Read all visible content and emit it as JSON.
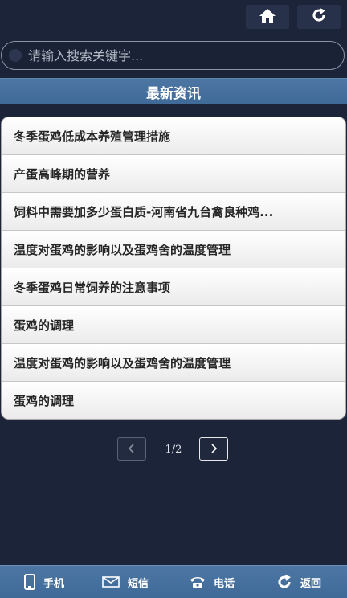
{
  "search": {
    "placeholder": "请输入搜索关键字..."
  },
  "section": {
    "title": "最新资讯"
  },
  "news": [
    "冬季蛋鸡低成本养殖管理措施",
    "产蛋高峰期的营养",
    "饲料中需要加多少蛋白质-河南省九台禽良种鸡...",
    "温度对蛋鸡的影响以及蛋鸡舍的温度管理",
    "冬季蛋鸡日常饲养的注意事项",
    "蛋鸡的调理",
    "温度对蛋鸡的影响以及蛋鸡舍的温度管理",
    "蛋鸡的调理"
  ],
  "pager": {
    "info": "1/2"
  },
  "footer": {
    "phone": "手机",
    "sms": "短信",
    "call": "电话",
    "back": "返回"
  },
  "icons": {
    "home": "home-icon",
    "refresh": "refresh-icon",
    "prev": "chevron-left-icon",
    "next": "chevron-right-icon",
    "mobile": "mobile-icon",
    "mail": "mail-icon",
    "telephone": "telephone-icon",
    "back": "back-arrow-icon"
  },
  "colors": {
    "background": "#1b2439",
    "accent": "#4d76a3",
    "list_bg": "#ffffff",
    "list_text": "#262626"
  }
}
